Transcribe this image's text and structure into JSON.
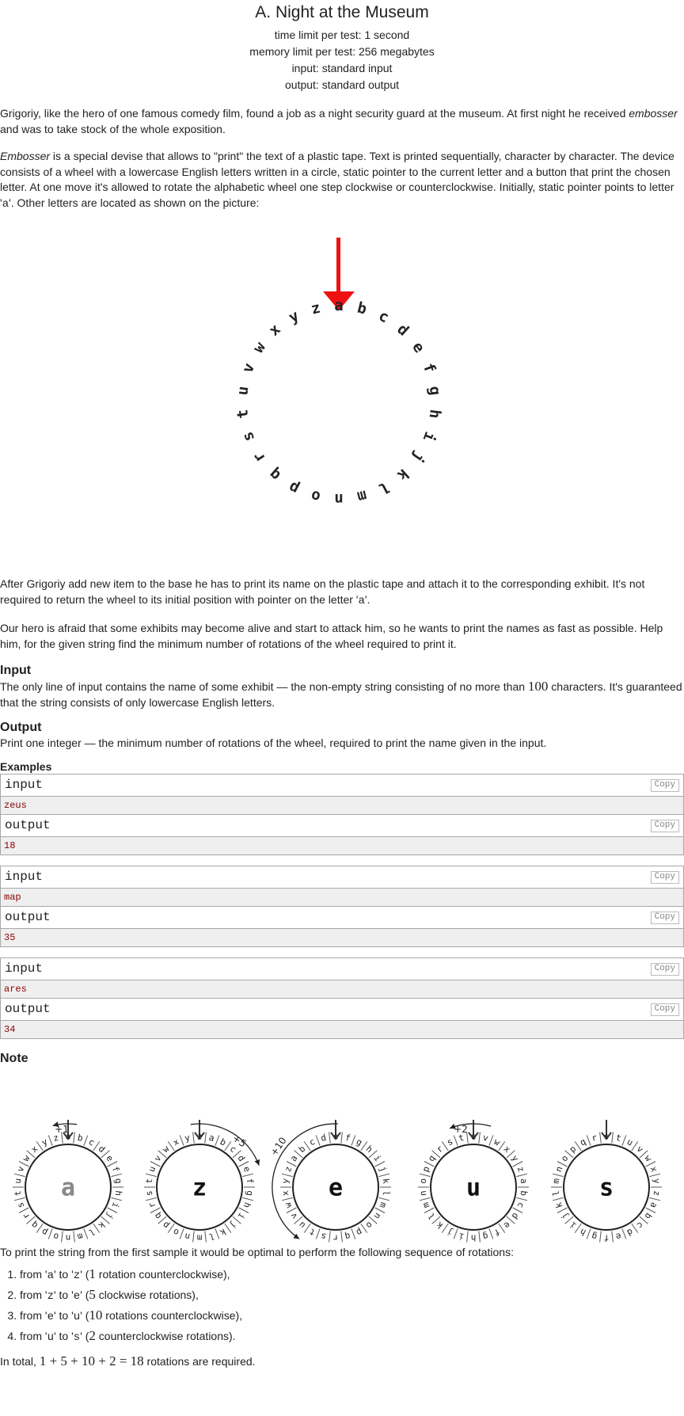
{
  "problem": {
    "title": "A. Night at the Museum",
    "time_limit": "time limit per test: 1 second",
    "memory_limit": "memory limit per test: 256 megabytes",
    "input_file": "input: standard input",
    "output_file": "output: standard output"
  },
  "statement": {
    "p1_a": "Grigoriy, like the hero of one famous comedy film, found a job as a night security guard at the museum. At first night he received ",
    "p1_em": "embosser",
    "p1_b": " and was to take stock of the whole exposition.",
    "p2_em": "Embosser",
    "p2_a": " is a special devise that allows to \"print\" the text of a plastic tape. Text is printed sequentially, character by character. The device consists of a wheel with a lowercase English letters written in a circle, static pointer to the current letter and a button that print the chosen letter. At one move it's allowed to rotate the alphabetic wheel one step clockwise or counterclockwise. Initially, static pointer points to letter '",
    "p2_code": "a",
    "p2_b": "'. Other letters are located as shown on the picture:",
    "p3_a": "After Grigoriy add new item to the base he has to print its name on the plastic tape and attach it to the corresponding exhibit. It's not required to return the wheel to its initial position with pointer on the letter '",
    "p3_code": "a",
    "p3_b": "'.",
    "p4": "Our hero is afraid that some exhibits may become alive and start to attack him, so he wants to print the names as fast as possible. Help him, for the given string find the minimum number of rotations of the wheel required to print it."
  },
  "wheel": {
    "letters": [
      "a",
      "b",
      "c",
      "d",
      "e",
      "f",
      "g",
      "h",
      "i",
      "j",
      "k",
      "l",
      "m",
      "n",
      "o",
      "p",
      "q",
      "r",
      "s",
      "t",
      "u",
      "v",
      "w",
      "x",
      "y",
      "z"
    ],
    "pointer_color": "#ee1111"
  },
  "input_section": {
    "title": "Input",
    "text_a": "The only line of input contains the name of some exhibit — the non-empty string consisting of no more than ",
    "text_num": "100",
    "text_b": " characters. It's guaranteed that the string consists of only lowercase English letters."
  },
  "output_section": {
    "title": "Output",
    "text": "Print one integer — the minimum number of rotations of the wheel, required to print the name given in the input."
  },
  "examples": {
    "title": "Examples",
    "input_label": "input",
    "output_label": "output",
    "copy_label": "Copy",
    "items": [
      {
        "input": "zeus",
        "output": "18"
      },
      {
        "input": "map",
        "output": "35"
      },
      {
        "input": "ares",
        "output": "34"
      }
    ]
  },
  "note": {
    "title": "Note",
    "wheels": [
      {
        "center": "a",
        "rotation": "+1"
      },
      {
        "center": "z",
        "rotation": "+5"
      },
      {
        "center": "e",
        "rotation": "+10"
      },
      {
        "center": "u",
        "rotation": "+2"
      },
      {
        "center": "s",
        "rotation": ""
      }
    ],
    "intro": "To print the string from the first sample it would be optimal to perform the following sequence of rotations:",
    "steps": [
      {
        "from": "a",
        "to": "z",
        "num": "1",
        "rest": " rotation counterclockwise),"
      },
      {
        "from": "z",
        "to": "e",
        "num": "5",
        "rest": " clockwise rotations),"
      },
      {
        "from": "e",
        "to": "u",
        "num": "10",
        "rest": " rotations counterclockwise),"
      },
      {
        "from": "u",
        "to": "s",
        "num": "2",
        "rest": " counterclockwise rotations)."
      }
    ],
    "total_a": "In total, ",
    "total_math": "1 + 5 + 10 + 2 = 18",
    "total_b": " rotations are required."
  }
}
